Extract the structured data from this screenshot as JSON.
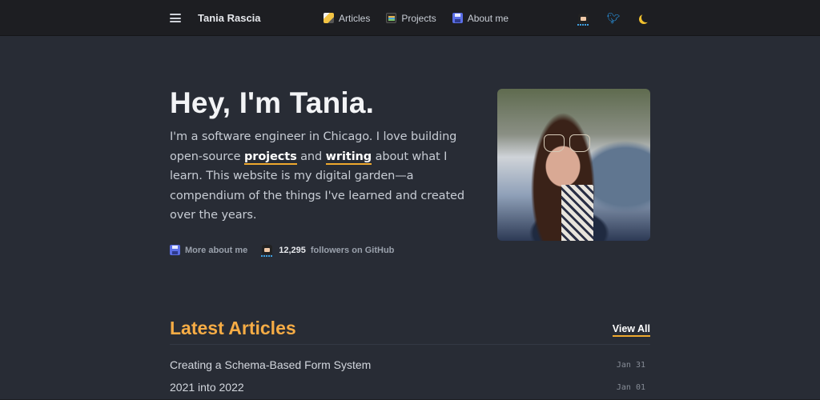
{
  "navbar": {
    "brand": "Tania Rascia",
    "menu_icon": "hamburger-icon",
    "links": [
      {
        "label": "Articles",
        "icon": "memo-pencil-icon"
      },
      {
        "label": "Projects",
        "icon": "tv-icon"
      },
      {
        "label": "About me",
        "icon": "floppy-disk-icon"
      }
    ],
    "right_icons": [
      "github-octocat-icon",
      "twitter-bird-icon",
      "moon-theme-icon"
    ]
  },
  "hero": {
    "heading": "Hey, I'm Tania.",
    "intro_before": "I'm a software engineer in Chicago. I love building open-source ",
    "link_projects": "projects",
    "intro_middle": " and ",
    "link_writing": "writing",
    "intro_after": " about what I learn. This website is my digital garden—a compendium of the things I've learned and created over the years.",
    "more_about_label": "More about me",
    "github_followers_count": "12,295",
    "github_followers_label": "followers on GitHub"
  },
  "latest_articles": {
    "title": "Latest Articles",
    "view_all_label": "View All",
    "items": [
      {
        "title": "Creating a Schema-Based Form System",
        "date": "Jan 31"
      },
      {
        "title": "2021 into 2022",
        "date": "Jan 01"
      }
    ]
  },
  "colors": {
    "background": "#282c35",
    "navbar": "#1d1e22",
    "accent": "#f6ac45",
    "link_underline": "#f0a92e"
  }
}
